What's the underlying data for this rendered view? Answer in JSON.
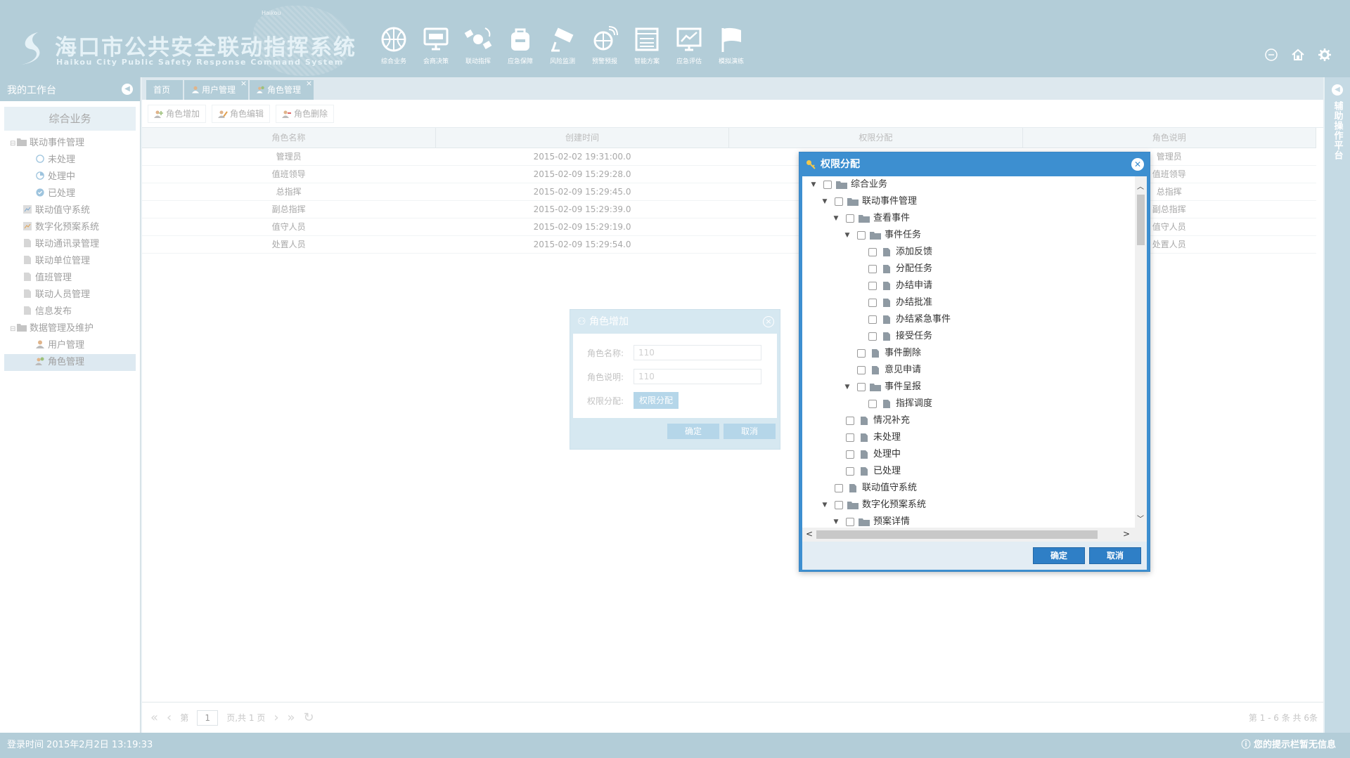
{
  "header": {
    "map_label": "Haikou",
    "title": "海口市公共安全联动指挥系统",
    "subtitle": "Haikou City Public Safety Response Command System",
    "nav": [
      {
        "label": "综合业务",
        "icon": "basketball-icon"
      },
      {
        "label": "会商决策",
        "icon": "monitor-icon"
      },
      {
        "label": "联动指挥",
        "icon": "satellite-icon"
      },
      {
        "label": "应急保障",
        "icon": "backpack-icon"
      },
      {
        "label": "风险监测",
        "icon": "camera-icon"
      },
      {
        "label": "预警预报",
        "icon": "radar-icon"
      },
      {
        "label": "智能方案",
        "icon": "document-icon"
      },
      {
        "label": "应急评估",
        "icon": "chart-icon"
      },
      {
        "label": "模拟演练",
        "icon": "flag-icon"
      }
    ]
  },
  "sidebar": {
    "title": "我的工作台",
    "group": "综合业务",
    "items": [
      {
        "label": "联动事件管理"
      },
      {
        "label": "未处理"
      },
      {
        "label": "处理中"
      },
      {
        "label": "已处理"
      },
      {
        "label": "联动值守系统"
      },
      {
        "label": "数字化预案系统"
      },
      {
        "label": "联动通讯录管理"
      },
      {
        "label": "联动单位管理"
      },
      {
        "label": "值班管理"
      },
      {
        "label": "联动人员管理"
      },
      {
        "label": "信息发布"
      },
      {
        "label": "数据管理及维护"
      },
      {
        "label": "用户管理"
      },
      {
        "label": "角色管理"
      }
    ]
  },
  "right_panel": {
    "label": "辅助操作平台"
  },
  "tabs": [
    {
      "label": "首页"
    },
    {
      "label": "用户管理",
      "close": "×"
    },
    {
      "label": "角色管理",
      "close": "×"
    }
  ],
  "toolbar": {
    "add": "角色增加",
    "edit": "角色编辑",
    "delete": "角色删除"
  },
  "table": {
    "columns": [
      "角色名称",
      "创建时间",
      "权限分配",
      "角色说明"
    ],
    "rows": [
      {
        "name": "管理员",
        "time": "2015-02-02 19:31:00.0",
        "desc": "管理员"
      },
      {
        "name": "值班领导",
        "time": "2015-02-09 15:29:28.0",
        "desc": "值班领导"
      },
      {
        "name": "总指挥",
        "time": "2015-02-09 15:29:45.0",
        "desc": "总指挥"
      },
      {
        "name": "副总指挥",
        "time": "2015-02-09 15:29:39.0",
        "desc": "副总指挥"
      },
      {
        "name": "值守人员",
        "time": "2015-02-09 15:29:19.0",
        "desc": "值守人员"
      },
      {
        "name": "处置人员",
        "time": "2015-02-09 15:29:54.0",
        "desc": "处置人员"
      }
    ]
  },
  "pager": {
    "page_prefix": "第",
    "page_value": "1",
    "page_suffix": "页,共 1 页",
    "summary": "第 1 - 6 条 共 6条"
  },
  "status": {
    "login": "登录时间  2015年2月2日   13:19:33",
    "hint": "您的提示栏暂无信息"
  },
  "add_dialog": {
    "title": "角色增加",
    "name_label": "角色名称:",
    "name_value": "110",
    "desc_label": "角色说明:",
    "desc_value": "110",
    "perm_label": "权限分配:",
    "perm_button": "权限分配",
    "ok": "确定",
    "cancel": "取消"
  },
  "perm_dialog": {
    "title": "权限分配",
    "ok": "确定",
    "cancel": "取消",
    "tree": [
      {
        "label": "综合业务",
        "level": 0,
        "toggle": "▼",
        "type": "folder"
      },
      {
        "label": "联动事件管理",
        "level": 1,
        "toggle": "▼",
        "type": "folder"
      },
      {
        "label": "查看事件",
        "level": 2,
        "toggle": "▼",
        "type": "folder"
      },
      {
        "label": "事件任务",
        "level": 3,
        "toggle": "▼",
        "type": "folder"
      },
      {
        "label": "添加反馈",
        "level": 4,
        "toggle": "",
        "type": "file"
      },
      {
        "label": "分配任务",
        "level": 4,
        "toggle": "",
        "type": "file"
      },
      {
        "label": "办结申请",
        "level": 4,
        "toggle": "",
        "type": "file"
      },
      {
        "label": "办结批准",
        "level": 4,
        "toggle": "",
        "type": "file"
      },
      {
        "label": "办结紧急事件",
        "level": 4,
        "toggle": "",
        "type": "file"
      },
      {
        "label": "接受任务",
        "level": 4,
        "toggle": "",
        "type": "file"
      },
      {
        "label": "事件删除",
        "level": 3,
        "toggle": "",
        "type": "file"
      },
      {
        "label": "意见申请",
        "level": 3,
        "toggle": "",
        "type": "file"
      },
      {
        "label": "事件呈报",
        "level": 3,
        "toggle": "▼",
        "type": "folder"
      },
      {
        "label": "指挥调度",
        "level": 4,
        "toggle": "",
        "type": "file"
      },
      {
        "label": "情况补充",
        "level": 2,
        "toggle": "",
        "type": "file"
      },
      {
        "label": "未处理",
        "level": 2,
        "toggle": "",
        "type": "file"
      },
      {
        "label": "处理中",
        "level": 2,
        "toggle": "",
        "type": "file"
      },
      {
        "label": "已处理",
        "level": 2,
        "toggle": "",
        "type": "file"
      },
      {
        "label": "联动值守系统",
        "level": 1,
        "toggle": "",
        "type": "file"
      },
      {
        "label": "数字化预案系统",
        "level": 1,
        "toggle": "▼",
        "type": "folder"
      },
      {
        "label": "预案详情",
        "level": 2,
        "toggle": "▼",
        "type": "folder"
      }
    ]
  },
  "colors": {
    "header": "#b3cdd8",
    "dialog": "#3d8fd0",
    "button": "#2f7fc6"
  }
}
